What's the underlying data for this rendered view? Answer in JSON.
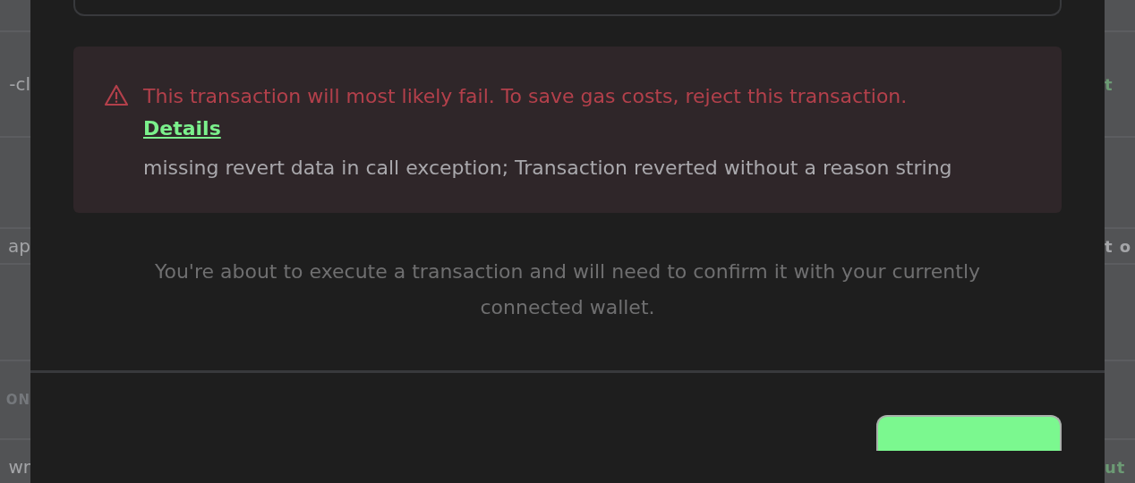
{
  "background": {
    "left_rows": [
      {
        "text": "-cl",
        "kind": "plain"
      },
      {
        "text": "ap",
        "kind": "plain"
      },
      {
        "text": "ON",
        "kind": "heading"
      },
      {
        "text": "wr",
        "kind": "plain"
      }
    ],
    "right_rows": [
      {
        "text": "t",
        "kind": "accent"
      },
      {
        "text": "t o",
        "kind": "bold"
      },
      {
        "text": "ut",
        "kind": "accent"
      }
    ]
  },
  "modal": {
    "warning": {
      "message": "This transaction will most likely fail. To save gas costs, reject this transaction.",
      "link": "Details",
      "detail": "missing revert data in call exception; Transaction reverted without a reason string"
    },
    "note": "You're about to execute a transaction and will need to confirm it with your currently connected wallet."
  }
}
